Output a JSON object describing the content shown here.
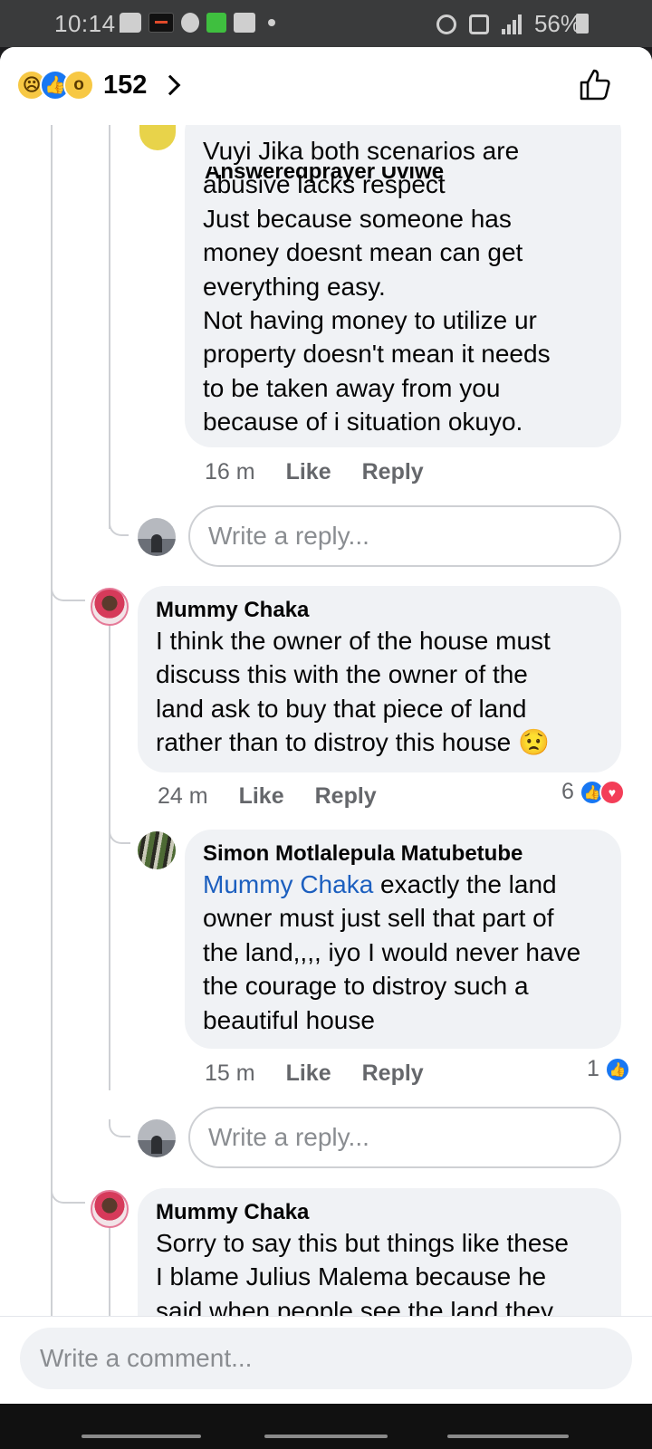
{
  "status_bar": {
    "time": "10:14",
    "battery": "56%"
  },
  "header": {
    "reaction_icons": [
      "sad-emoji",
      "like",
      "wow-emoji"
    ],
    "reaction_count": "152"
  },
  "comments": [
    {
      "author": "Answeredprayer Uviwe",
      "text": [
        "Vuyi Jika both scenarios are",
        "abusive lacks respect",
        "Just because someone has",
        "money doesnt mean can get",
        "everything easy.",
        "Not having money to utilize ur",
        "property doesn't mean it needs",
        "to be taken away from you",
        "because of i situation okuyo."
      ],
      "time": "16 m",
      "like": "Like",
      "reply": "Reply"
    },
    {
      "author": "Mummy Chaka",
      "text": [
        "I think the owner of the house must",
        "discuss this with the owner of the",
        "land ask to buy that piece of land",
        "rather than to distroy this house 😟"
      ],
      "time": "24 m",
      "like": "Like",
      "reply": "Reply",
      "reactions": "6"
    },
    {
      "author": "Simon Motlalepula Matubetube",
      "mention": "Mummy Chaka",
      "text_after_mention": " exactly the land",
      "text": [
        "owner must just sell that part of",
        "the land,,,, iyo I would never have",
        "the courage to distroy such a",
        "beautiful house"
      ],
      "time": "15 m",
      "like": "Like",
      "reply": "Reply",
      "reactions": "1"
    },
    {
      "author": "Mummy Chaka",
      "text": [
        "Sorry to say this but things like these",
        "I blame Julius Malema because he",
        "said when people see the land they"
      ]
    }
  ],
  "reply_placeholder": "Write a reply...",
  "comment_placeholder": "Write a comment..."
}
